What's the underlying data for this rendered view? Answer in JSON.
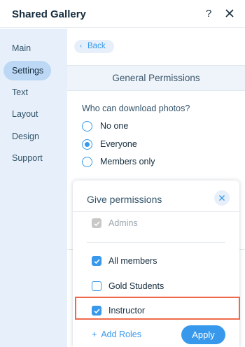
{
  "window": {
    "title": "Shared Gallery",
    "help_glyph": "?",
    "help_icon": "question-mark-icon",
    "close_icon": "close-icon"
  },
  "sidebar": {
    "active_index": 1,
    "items": [
      {
        "label": "Main"
      },
      {
        "label": "Settings"
      },
      {
        "label": "Text"
      },
      {
        "label": "Layout"
      },
      {
        "label": "Design"
      },
      {
        "label": "Support"
      }
    ]
  },
  "main": {
    "back_label": "Back",
    "back_icon": "chevron-left-icon",
    "section_title": "General Permissions",
    "question": "Who can download photos?",
    "options": [
      {
        "label": "No one",
        "selected": false
      },
      {
        "label": "Everyone",
        "selected": true
      },
      {
        "label": "Members only",
        "selected": false
      }
    ]
  },
  "popup": {
    "title": "Give permissions",
    "close_icon": "close-icon",
    "roles": [
      {
        "label": "Admins",
        "checked": true,
        "disabled": true
      },
      {
        "label": "All members",
        "checked": true,
        "disabled": false
      },
      {
        "label": "Gold Students",
        "checked": false,
        "disabled": false
      },
      {
        "label": "Instructor",
        "checked": true,
        "disabled": false
      }
    ],
    "add_roles_label": "Add Roles",
    "add_icon": "plus-icon",
    "apply_label": "Apply"
  },
  "colors": {
    "accent": "#3899ec",
    "sidebar_bg": "#e7f0fa",
    "sidebar_active": "#bcd8f5",
    "highlight": "#ee6a4c"
  }
}
